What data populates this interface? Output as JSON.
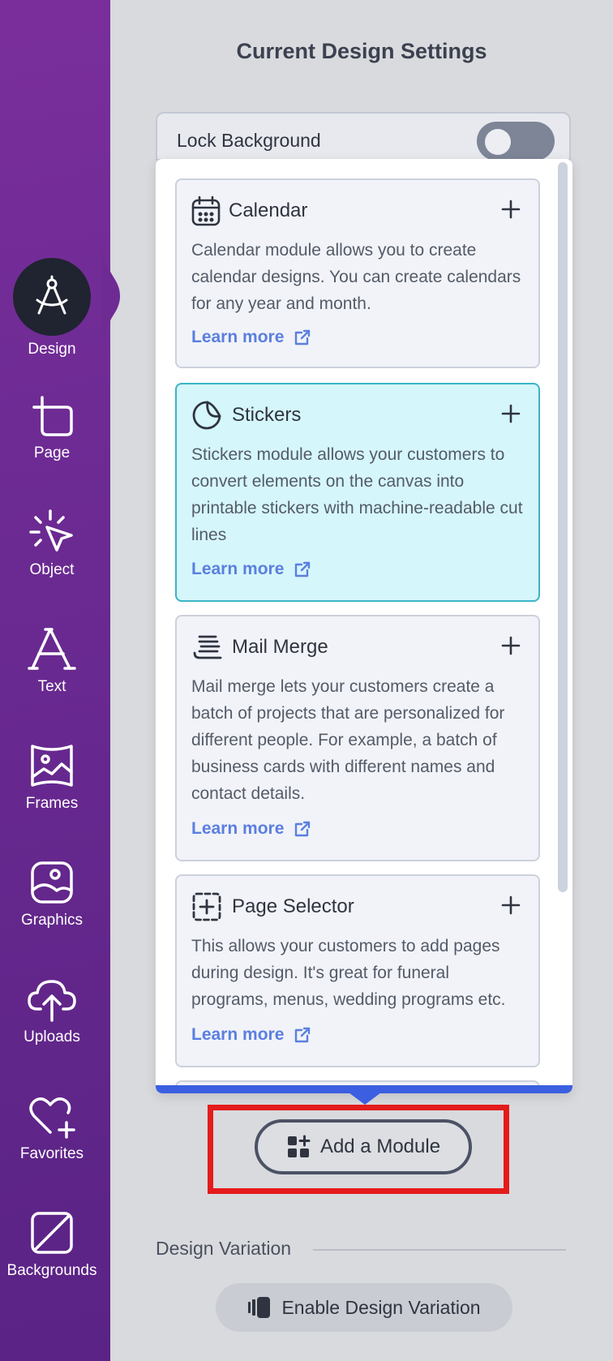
{
  "sidebar": {
    "items": [
      {
        "label": "Design",
        "icon": "compass-icon",
        "active": true
      },
      {
        "label": "Page",
        "icon": "page-icon"
      },
      {
        "label": "Object",
        "icon": "cursor-click-icon"
      },
      {
        "label": "Text",
        "icon": "text-icon"
      },
      {
        "label": "Frames",
        "icon": "frame-icon"
      },
      {
        "label": "Graphics",
        "icon": "image-icon"
      },
      {
        "label": "Uploads",
        "icon": "cloud-upload-icon"
      },
      {
        "label": "Favorites",
        "icon": "heart-plus-icon"
      },
      {
        "label": "Backgrounds",
        "icon": "background-icon"
      }
    ]
  },
  "panel": {
    "title": "Current Design Settings",
    "lock_background_label": "Lock Background",
    "lock_background_on": false
  },
  "modules": [
    {
      "name": "Calendar",
      "icon": "calendar-icon",
      "description": "Calendar module allows you to create calendar designs. You can create calendars for any year and month.",
      "learn_more": "Learn more"
    },
    {
      "name": "Stickers",
      "icon": "sticker-icon",
      "description": "Stickers module allows your customers to convert elements on the canvas into printable stickers with machine-readable cut lines",
      "learn_more": "Learn more"
    },
    {
      "name": "Mail Merge",
      "icon": "stack-icon",
      "description": "Mail merge lets your customers create a batch of projects that are personalized for different people. For example, a batch of business cards with different names and contact details.",
      "learn_more": "Learn more"
    },
    {
      "name": "Page Selector",
      "icon": "page-add-icon",
      "description": "This allows your customers to add pages during design. It's great for funeral programs, menus, wedding programs etc.",
      "learn_more": "Learn more"
    }
  ],
  "add_module_label": "Add a Module",
  "design_variation": {
    "heading": "Design Variation",
    "enable_label": "Enable Design Variation"
  },
  "colors": {
    "sidebar": "#6b2a92",
    "highlight_card": "#d5f6fb",
    "link": "#5b7fe0",
    "dropdown_accent": "#3b5fe0",
    "annotation_box": "#e41b1b"
  }
}
